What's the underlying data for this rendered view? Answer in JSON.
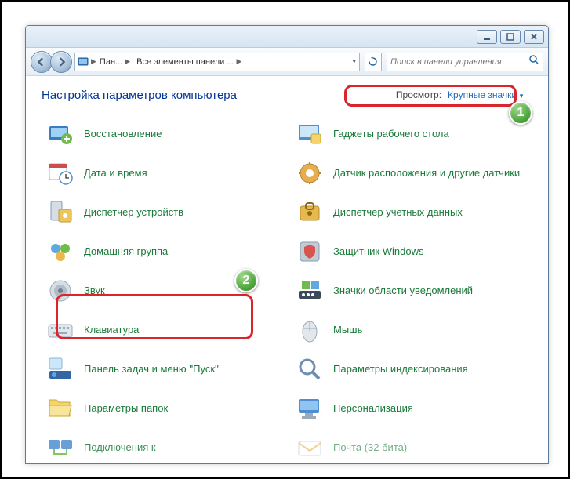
{
  "breadcrumb": {
    "seg1": "Пан...",
    "seg2": "Все элементы панели ..."
  },
  "search": {
    "placeholder": "Поиск в панели управления"
  },
  "page": {
    "title": "Настройка параметров компьютера"
  },
  "view": {
    "label": "Просмотр:",
    "value": "Крупные значки"
  },
  "items": {
    "left": [
      {
        "label": "Восстановление",
        "icon": "restore"
      },
      {
        "label": "Дата и время",
        "icon": "datetime"
      },
      {
        "label": "Диспетчер устройств",
        "icon": "devmgr"
      },
      {
        "label": "Домашняя группа",
        "icon": "homegroup"
      },
      {
        "label": "Звук",
        "icon": "sound"
      },
      {
        "label": "Клавиатура",
        "icon": "keyboard"
      },
      {
        "label": "Панель задач и меню ''Пуск''",
        "icon": "taskbar"
      },
      {
        "label": "Параметры папок",
        "icon": "folder"
      },
      {
        "label": "Подключения к",
        "icon": "connect"
      }
    ],
    "right": [
      {
        "label": "Гаджеты рабочего стола",
        "icon": "gadgets"
      },
      {
        "label": "Датчик расположения и другие датчики",
        "icon": "sensor"
      },
      {
        "label": "Диспетчер учетных данных",
        "icon": "cred"
      },
      {
        "label": "Защитник Windows",
        "icon": "defender"
      },
      {
        "label": "Значки области уведомлений",
        "icon": "tray"
      },
      {
        "label": "Мышь",
        "icon": "mouse"
      },
      {
        "label": "Параметры индексирования",
        "icon": "index"
      },
      {
        "label": "Персонализация",
        "icon": "personalize"
      },
      {
        "label": "Почта (32 бита)",
        "icon": "mail"
      }
    ]
  },
  "badges": {
    "one": "1",
    "two": "2"
  }
}
